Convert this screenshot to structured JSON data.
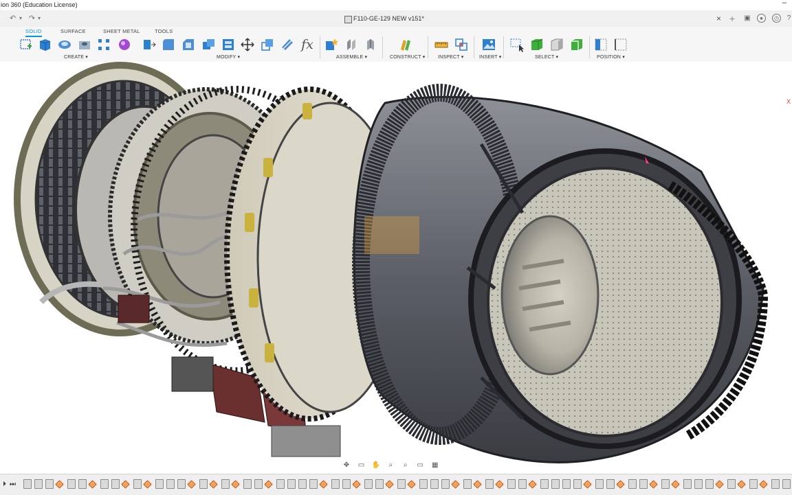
{
  "window": {
    "title": "ion 360 (Education License)"
  },
  "document_tab": {
    "name": "F110-GE-129 NEW v151*"
  },
  "workspace_tabs": [
    "SOLID",
    "SURFACE",
    "SHEET METAL",
    "TOOLS"
  ],
  "toolbar_groups": {
    "create": "CREATE ▾",
    "modify": "MODIFY ▾",
    "assemble": "ASSEMBLE ▾",
    "construct": "CONSTRUCT ▾",
    "inspect": "INSPECT ▾",
    "insert": "INSERT ▾",
    "select": "SELECT ▾",
    "position": "POSITION ▾"
  },
  "tool_icons": {
    "create": [
      "sketch-icon",
      "extrude-icon",
      "revolve-icon",
      "hole-icon",
      "rectangular-pattern-icon",
      "form-icon"
    ],
    "modify": [
      "press-pull-icon",
      "fillet-icon",
      "chamfer-icon",
      "combine-icon",
      "shell-icon",
      "move-icon",
      "scale-icon",
      "split-body-icon",
      "parameters-icon"
    ],
    "assemble": [
      "new-component-icon",
      "joint-icon",
      "as-built-joint-icon"
    ],
    "construct": [
      "offset-plane-icon"
    ],
    "inspect": [
      "measure-icon",
      "interference-icon"
    ],
    "insert": [
      "insert-image-icon"
    ],
    "select": [
      "select-window-icon",
      "select-body-icon",
      "select-face-icon",
      "select-edge-icon"
    ],
    "position": [
      "capture-position-icon",
      "revert-position-icon"
    ]
  },
  "axis_label": "X",
  "param_fx": "fx",
  "colors": {
    "accent": "#0696d7",
    "timeline_marker": "#f2a15a",
    "engine_case": "#5e6068",
    "dark_ring": "#2a2b30"
  }
}
